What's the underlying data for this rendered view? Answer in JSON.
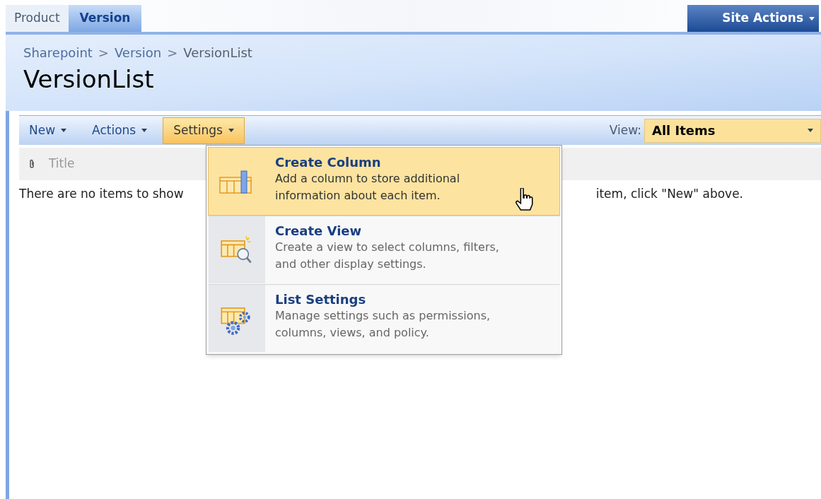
{
  "tabs": [
    {
      "label": "Product",
      "selected": false
    },
    {
      "label": "Version",
      "selected": true
    }
  ],
  "site_actions": {
    "label": "Site Actions"
  },
  "breadcrumb": [
    "Sharepoint",
    "Version",
    "VersionList"
  ],
  "breadcrumb_separator": ">",
  "page_title": "VersionList",
  "toolbar": {
    "menus": [
      {
        "label": "New",
        "selected": false
      },
      {
        "label": "Actions",
        "selected": false
      },
      {
        "label": "Settings",
        "selected": true
      }
    ],
    "view_label": "View:",
    "view_value": "All Items"
  },
  "list": {
    "columns": [
      "Title"
    ],
    "empty_message_start": "There are no items to show",
    "empty_message_end": "item, click \"New\" above."
  },
  "settings_menu": [
    {
      "kind": "column",
      "title": "Create Column",
      "description": "Add a column to store additional information about each item.",
      "selected": true
    },
    {
      "kind": "view",
      "title": "Create View",
      "description": "Create a view to select columns, filters, and other display settings.",
      "selected": false
    },
    {
      "kind": "settings",
      "title": "List Settings",
      "description": "Manage settings such as permissions, columns, views, and policy.",
      "selected": false
    }
  ]
}
